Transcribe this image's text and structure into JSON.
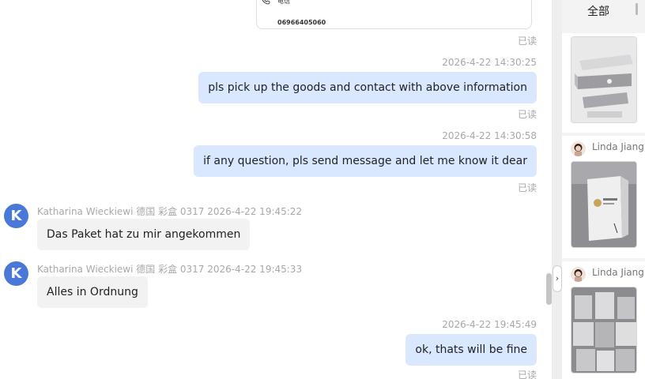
{
  "card": {
    "phone_label": "电话",
    "phone_number": "06966405060"
  },
  "messages": [
    {
      "read": "已读"
    },
    {
      "time": "2026-4-22 14:30:25",
      "text": "pls pick up the goods and contact with above information",
      "read": "已读"
    },
    {
      "time": "2026-4-22 14:30:58",
      "text": "if any question, pls send message and let me know it dear",
      "read": "已读"
    },
    {
      "avatar_letter": "K",
      "sender": "Katharina Wieckiewi 德国 彩盒 0317",
      "time": "2026-4-22 19:45:22",
      "text": "Das Paket hat zu mir angekommen"
    },
    {
      "avatar_letter": "K",
      "sender": "Katharina Wieckiewi 德国 彩盒 0317",
      "time": "2026-4-22 19:45:33",
      "text": "Alles in Ordnung"
    },
    {
      "time": "2026-4-22 19:45:49",
      "text": "ok, thats will be fine",
      "read": "已读"
    }
  ],
  "sidebar": {
    "tab_all": "全部",
    "items": [
      {
        "user": ""
      },
      {
        "user": "Linda Jiang"
      },
      {
        "user": "Linda Jiang"
      }
    ]
  },
  "colors": {
    "bubble_out": "#d9e8ff",
    "bubble_in": "#f2f2f2",
    "avatar_bg": "#4a78d8",
    "muted_text": "#a8a8a8"
  },
  "icons": {
    "phone": "phone-icon",
    "collapse": "chevron-right-icon"
  }
}
